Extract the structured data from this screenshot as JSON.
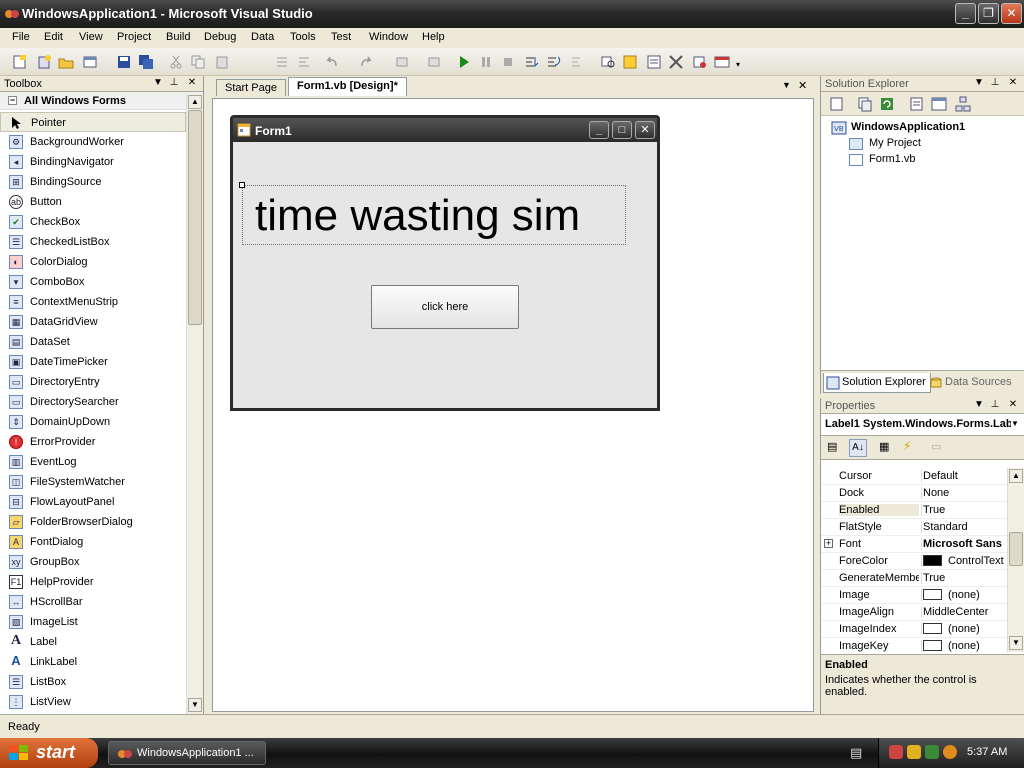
{
  "window": {
    "title": "WindowsApplication1 - Microsoft Visual Studio"
  },
  "menu": [
    "File",
    "Edit",
    "View",
    "Project",
    "Build",
    "Debug",
    "Data",
    "Tools",
    "Test",
    "Window",
    "Help"
  ],
  "toolbox": {
    "title": "Toolbox",
    "group": "All Windows Forms",
    "items": [
      "Pointer",
      "BackgroundWorker",
      "BindingNavigator",
      "BindingSource",
      "Button",
      "CheckBox",
      "CheckedListBox",
      "ColorDialog",
      "ComboBox",
      "ContextMenuStrip",
      "DataGridView",
      "DataSet",
      "DateTimePicker",
      "DirectoryEntry",
      "DirectorySearcher",
      "DomainUpDown",
      "ErrorProvider",
      "EventLog",
      "FileSystemWatcher",
      "FlowLayoutPanel",
      "FolderBrowserDialog",
      "FontDialog",
      "GroupBox",
      "HelpProvider",
      "HScrollBar",
      "ImageList",
      "Label",
      "LinkLabel",
      "ListBox",
      "ListView"
    ]
  },
  "tabs": {
    "start": "Start Page",
    "active": "Form1.vb [Design]*"
  },
  "form": {
    "title": "Form1",
    "label_text": "time wasting sim",
    "button_text": "click here"
  },
  "solution_explorer": {
    "title": "Solution Explorer",
    "root": "WindowsApplication1",
    "children": [
      "My Project",
      "Form1.vb"
    ],
    "tab_active": "Solution Explorer",
    "tab_other": "Data Sources"
  },
  "properties": {
    "title": "Properties",
    "selected_object": "Label1  System.Windows.Forms.Labe",
    "rows": [
      {
        "name": "Cursor",
        "value": "Default"
      },
      {
        "name": "Dock",
        "value": "None"
      },
      {
        "name": "Enabled",
        "value": "True"
      },
      {
        "name": "FlatStyle",
        "value": "Standard"
      },
      {
        "name": "Font",
        "value": "Microsoft Sans"
      },
      {
        "name": "ForeColor",
        "value": "ControlText"
      },
      {
        "name": "GenerateMembe",
        "value": "True"
      },
      {
        "name": "Image",
        "value": "(none)"
      },
      {
        "name": "ImageAlign",
        "value": "MiddleCenter"
      },
      {
        "name": "ImageIndex",
        "value": "(none)"
      },
      {
        "name": "ImageKey",
        "value": "(none)"
      }
    ],
    "desc_title": "Enabled",
    "desc_text": "Indicates whether the control is enabled."
  },
  "status": {
    "text": "Ready"
  },
  "taskbar": {
    "start": "start",
    "task": "WindowsApplication1 ...",
    "clock": "5:37 AM"
  }
}
